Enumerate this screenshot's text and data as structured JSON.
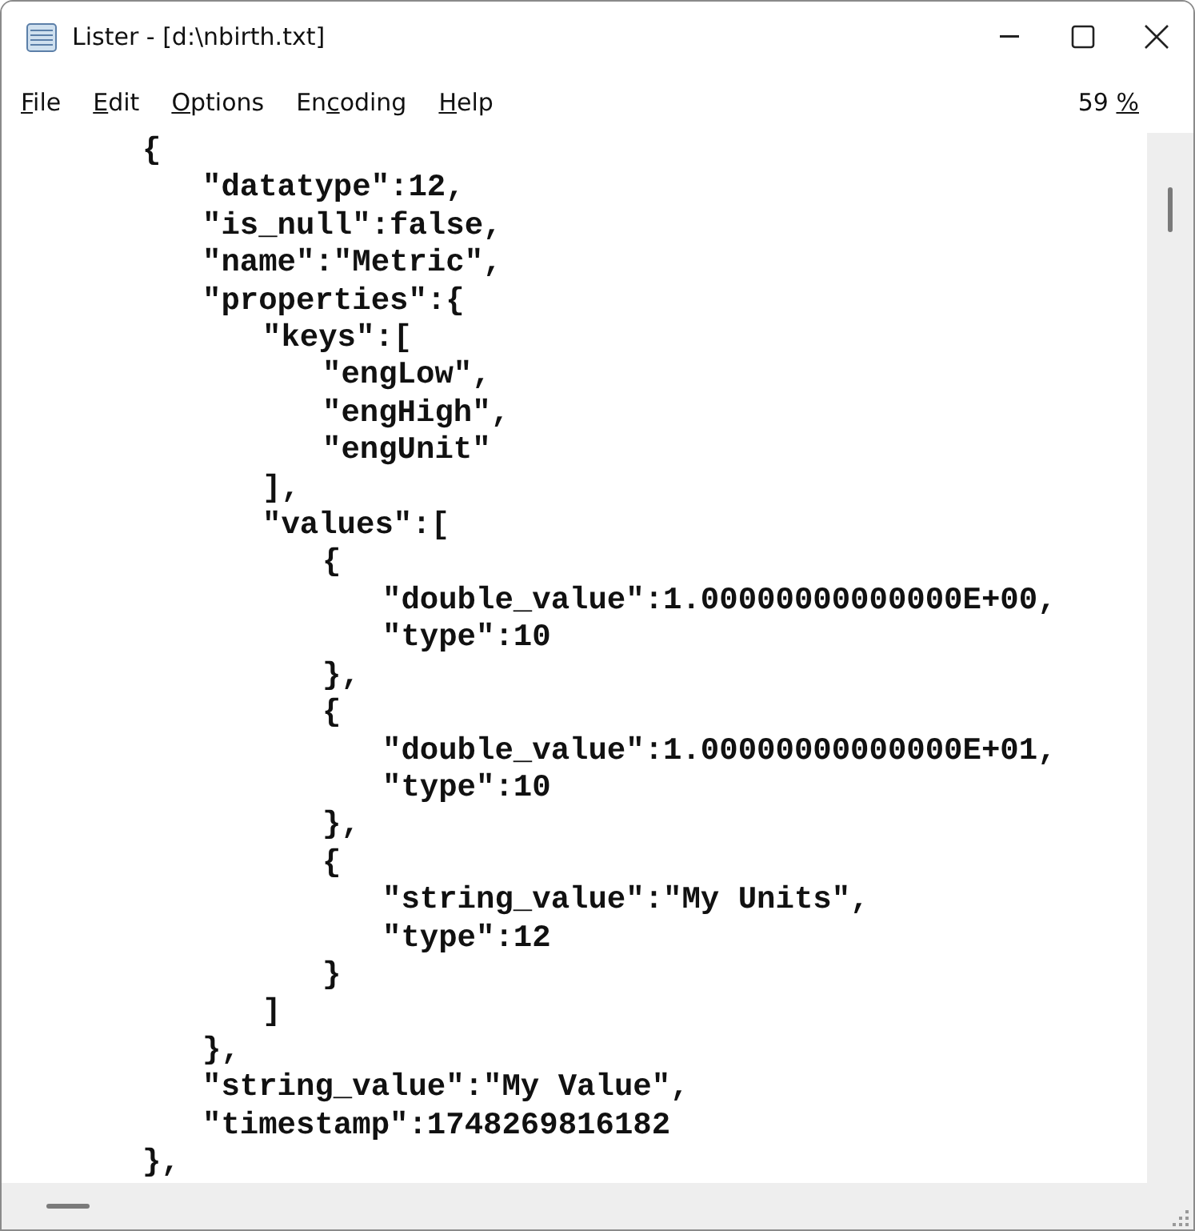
{
  "window": {
    "title": "Lister - [d:\\nbirth.txt]"
  },
  "menu": [
    {
      "key": "F",
      "after": "ile"
    },
    {
      "key": "E",
      "after": "dit"
    },
    {
      "key": "O",
      "after": "ptions"
    },
    {
      "before": "En",
      "key": "c",
      "after": "oding"
    },
    {
      "key": "H",
      "after": "elp"
    }
  ],
  "zoom": {
    "before": "59 ",
    "key": "%"
  },
  "lines": [
    {
      "text": "{",
      "children": [
        {
          "text": "\"datatype\":12,"
        },
        {
          "text": "\"is_null\":false,"
        },
        {
          "text": "\"name\":\"Metric\","
        },
        {
          "text": "\"properties\":{",
          "children": [
            {
              "text": "\"keys\":[",
              "children": [
                {
                  "text": "\"engLow\","
                },
                {
                  "text": "\"engHigh\","
                },
                {
                  "text": "\"engUnit\""
                }
              ]
            },
            {
              "text": "],"
            },
            {
              "text": "\"values\":[",
              "children": [
                {
                  "text": "{",
                  "children": [
                    {
                      "text": "\"double_value\":1.00000000000000E+00,"
                    },
                    {
                      "text": "\"type\":10"
                    }
                  ]
                },
                {
                  "text": "},"
                },
                {
                  "text": "{",
                  "children": [
                    {
                      "text": "\"double_value\":1.00000000000000E+01,"
                    },
                    {
                      "text": "\"type\":10"
                    }
                  ]
                },
                {
                  "text": "},"
                },
                {
                  "text": "{",
                  "children": [
                    {
                      "text": "\"string_value\":\"My Units\","
                    },
                    {
                      "text": "\"type\":12"
                    }
                  ]
                },
                {
                  "text": "}"
                }
              ]
            },
            {
              "text": "]"
            }
          ]
        },
        {
          "text": "},"
        },
        {
          "text": "\"string_value\":\"My Value\","
        },
        {
          "text": "\"timestamp\":1748269816182"
        }
      ]
    },
    {
      "text": "},"
    }
  ]
}
